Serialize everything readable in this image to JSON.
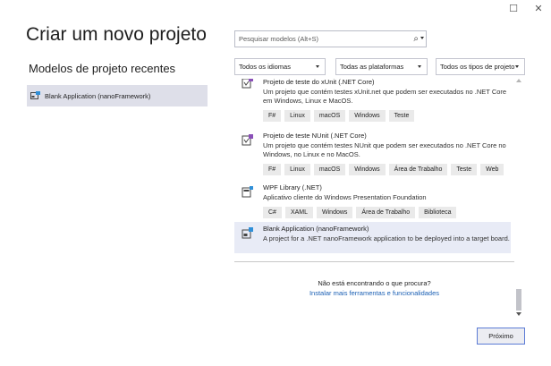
{
  "window": {
    "maximize_glyph": "☐",
    "close_glyph": "✕"
  },
  "page": {
    "title": "Criar um novo projeto"
  },
  "recent": {
    "heading": "Modelos de projeto recentes",
    "items": [
      {
        "label": "Blank Application (nanoFramework)",
        "icon": "nanoframework-project-icon"
      }
    ]
  },
  "search": {
    "placeholder": "Pesquisar modelos (Alt+S)",
    "value": ""
  },
  "filters": {
    "language": "Todos os idiomas",
    "platform": "Todas as plataformas",
    "project_type": "Todos os tipos de projeto"
  },
  "templates": [
    {
      "name": "Projeto de teste do xUnit (.NET Core)",
      "description": "Um projeto que contém testes xUnit.net que podem ser executados no .NET Core em Windows, Linux e MacOS.",
      "tags": [
        "F#",
        "Linux",
        "macOS",
        "Windows",
        "Teste"
      ],
      "icon": "test-project-icon"
    },
    {
      "name": "Projeto de teste NUnit (.NET Core)",
      "description": "Um projeto que contém testes NUnit que podem ser executados no .NET Core no Windows, no Linux e no MacOS.",
      "tags": [
        "F#",
        "Linux",
        "macOS",
        "Windows",
        "Área de Trabalho",
        "Teste",
        "Web"
      ],
      "icon": "test-project-icon"
    },
    {
      "name": "WPF Library (.NET)",
      "description": "Aplicativo cliente do Windows Presentation Foundation",
      "tags": [
        "C#",
        "XAML",
        "Windows",
        "Área de Trabalho",
        "Biblioteca"
      ],
      "icon": "wpf-library-icon"
    },
    {
      "name": "Blank Application (nanoFramework)",
      "description": "A project for a .NET nanoFramework application to be deployed into a target board.",
      "tags": [],
      "icon": "nanoframework-project-icon"
    }
  ],
  "not_found": {
    "question": "Não está encontrando o que procura?",
    "link": "Instalar mais ferramentas e funcionalidades"
  },
  "actions": {
    "next_label": "Próximo"
  },
  "colors": {
    "selected_bg": "#e8ebf6",
    "recent_selected_bg": "#dedfe9",
    "link": "#1a5fb4",
    "accent_border": "#5b7bd5"
  }
}
